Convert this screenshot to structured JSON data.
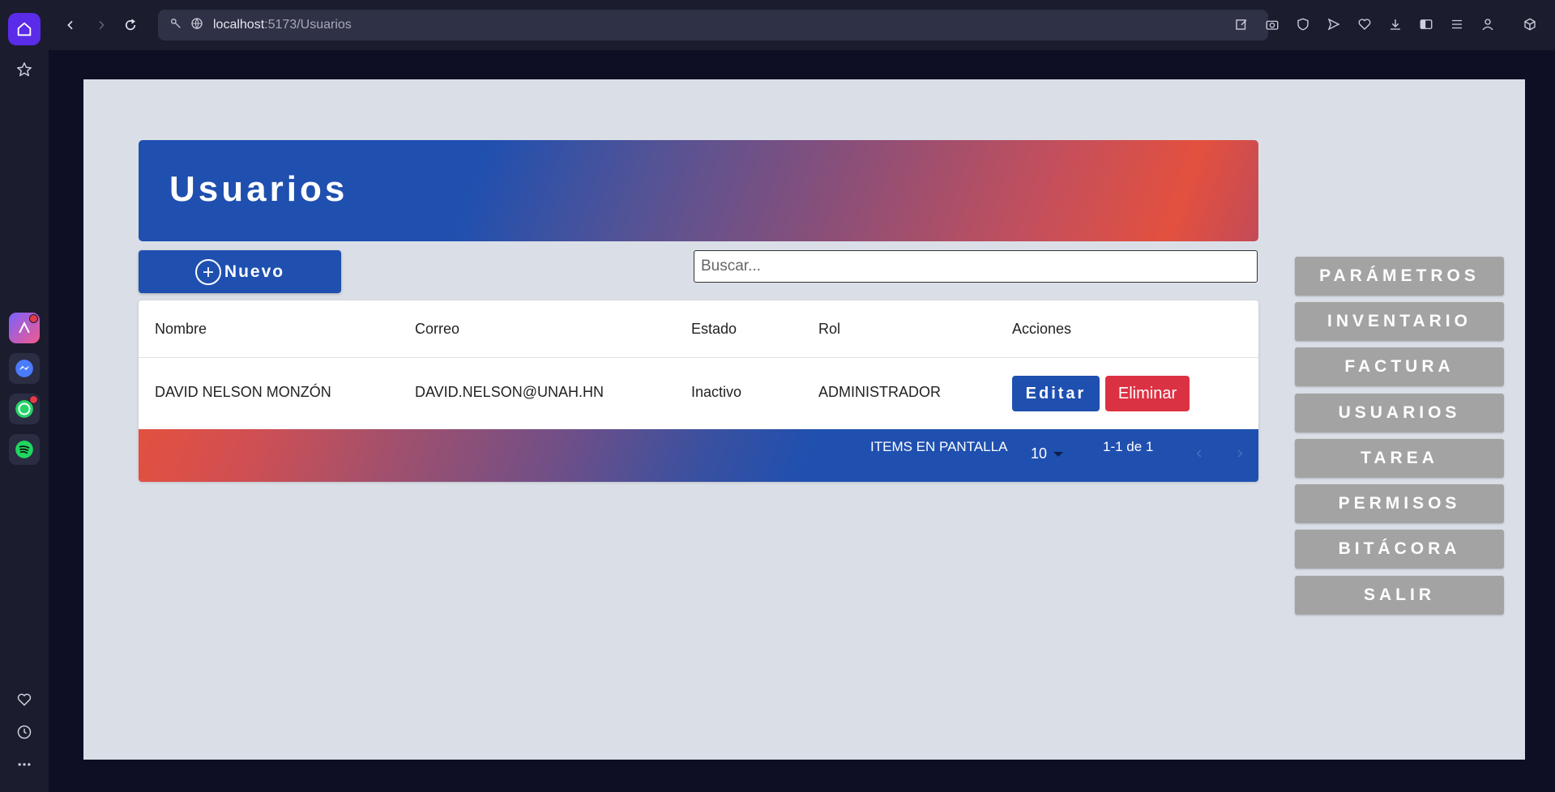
{
  "browser": {
    "url_host": "localhost",
    "url_path": ":5173/Usuarios"
  },
  "page": {
    "title": "Usuarios",
    "new_button_label": "Nuevo",
    "search_placeholder": "Buscar...",
    "table": {
      "headers": [
        "Nombre",
        "Correo",
        "Estado",
        "Rol",
        "Acciones"
      ],
      "rows": [
        {
          "nombre": "DAVID NELSON MONZÓN",
          "correo": "DAVID.NELSON@UNAH.HN",
          "estado": "Inactivo",
          "rol": "ADMINISTRADOR",
          "edit_label": "Editar",
          "delete_label": "Eliminar"
        }
      ]
    },
    "pagination": {
      "items_label": "ITEMS EN PANTALLA",
      "items_per_page": "10",
      "range": "1-1 de 1"
    }
  },
  "menu": {
    "items": [
      "PARÁMETROS",
      "INVENTARIO",
      "FACTURA",
      "USUARIOS",
      "TAREA",
      "PERMISOS",
      "BITÁCORA",
      "SALIR"
    ]
  },
  "colors": {
    "primary": "#1f50b0",
    "danger": "#db3243",
    "menu": "#a3a3a3",
    "page_bg": "#dadfe7"
  }
}
